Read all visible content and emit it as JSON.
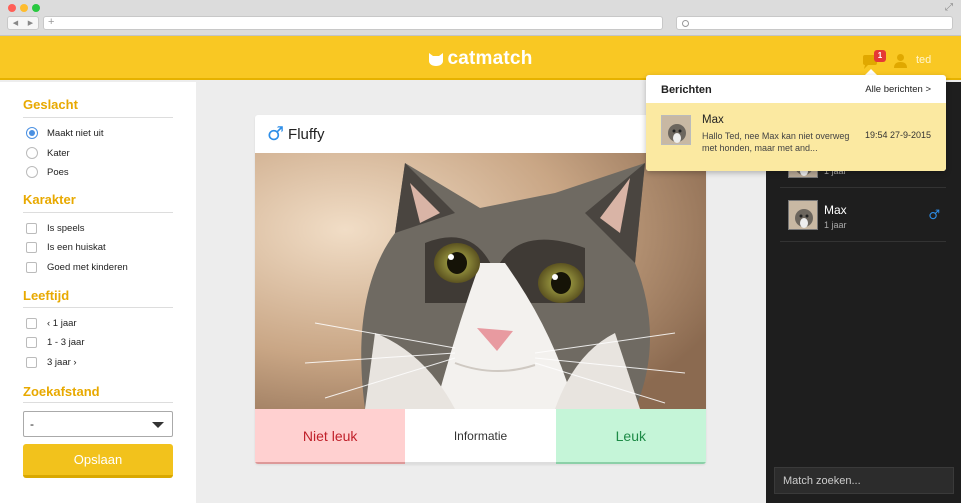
{
  "app": {
    "brand": "catmatch",
    "notification_count": "1",
    "username": "ted",
    "colors": {
      "accent": "#f9c823",
      "section_title": "#e8a900",
      "male": "#2d8ee8"
    }
  },
  "filters": {
    "gender": {
      "title": "Geslacht",
      "options": [
        "Maakt niet uit",
        "Kater",
        "Poes"
      ],
      "selected": "Maakt niet uit"
    },
    "character": {
      "title": "Karakter",
      "options": [
        "Is speels",
        "Is een huiskat",
        "Goed met kinderen"
      ]
    },
    "age": {
      "title": "Leeftijd",
      "options": [
        "‹ 1 jaar",
        "1 - 3 jaar",
        "3 jaar ›"
      ]
    },
    "distance": {
      "title": "Zoekafstand",
      "selected": "-"
    },
    "save_label": "Opslaan"
  },
  "card": {
    "name": "Fluffy",
    "gender_symbol": "♂",
    "actions": {
      "dislike": "Niet leuk",
      "info": "Informatie",
      "like": "Leuk"
    }
  },
  "matches": [
    {
      "name": "",
      "age": "1 jaar"
    },
    {
      "name": "Max",
      "age": "1 jaar",
      "gender_symbol": "♂"
    }
  ],
  "match_search_placeholder": "Match zoeken...",
  "notifications": {
    "title": "Berichten",
    "all_link": "Alle berichten >",
    "items": [
      {
        "from": "Max",
        "text": "Hallo Ted, nee Max kan niet overweg met honden, maar met and...",
        "time": "19:54 27-9-2015"
      }
    ]
  }
}
